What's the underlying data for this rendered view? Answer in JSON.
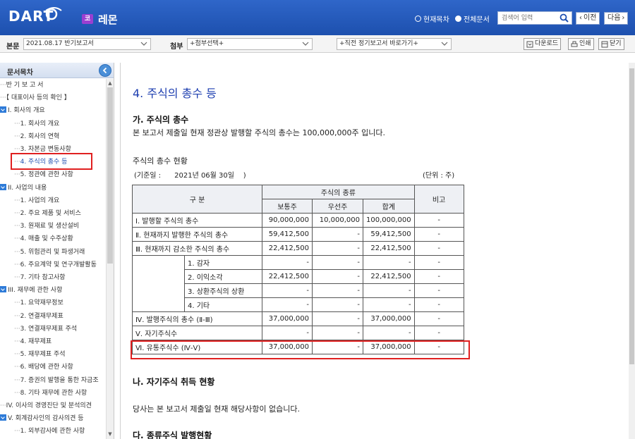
{
  "header": {
    "logo_text": "DART",
    "company_badge": "코",
    "company_name": "레몬",
    "radio_current": "현재목차",
    "radio_all": "전체문서",
    "search_placeholder": "검색어 입력",
    "prev_label": "이전",
    "next_label": "다음"
  },
  "toolbar": {
    "report_label": "본문",
    "report_value": "2021.08.17  반기보고서",
    "attach_label": "첨부",
    "attach_value": "+첨부선택+",
    "direct_value": "+직전 정기보고서 바로가기+",
    "download_label": "다운로드",
    "print_label": "인쇄",
    "close_label": "닫기"
  },
  "sidebar": {
    "title": "문서목차",
    "items": [
      {
        "label": "반 기 보 고 서",
        "prefix": "···",
        "indent": 0,
        "expander": false
      },
      {
        "label": "【 대표이사 등의 확인 】",
        "prefix": "···",
        "indent": 0,
        "expander": false
      },
      {
        "label": "I. 회사의 개요",
        "prefix": "",
        "indent": 0,
        "expander": true
      },
      {
        "label": "1. 회사의 개요",
        "prefix": "···",
        "indent": 1,
        "expander": false
      },
      {
        "label": "2. 회사의 연혁",
        "prefix": "···",
        "indent": 1,
        "expander": false
      },
      {
        "label": "3. 자본금 변동사항",
        "prefix": "···",
        "indent": 1,
        "expander": false
      },
      {
        "label": "4. 주식의 총수 등",
        "prefix": "···",
        "indent": 1,
        "expander": false,
        "active": true
      },
      {
        "label": "5. 정관에 관한 사항",
        "prefix": "···",
        "indent": 1,
        "expander": false
      },
      {
        "label": "II. 사업의 내용",
        "prefix": "",
        "indent": 0,
        "expander": true
      },
      {
        "label": "1. 사업의 개요",
        "prefix": "···",
        "indent": 1,
        "expander": false
      },
      {
        "label": "2. 주요 제품 및 서비스",
        "prefix": "···",
        "indent": 1,
        "expander": false
      },
      {
        "label": "3. 원재료 및 생산설비",
        "prefix": "···",
        "indent": 1,
        "expander": false
      },
      {
        "label": "4. 매출 및 수주상황",
        "prefix": "···",
        "indent": 1,
        "expander": false
      },
      {
        "label": "5. 위험관리 및 파생거래",
        "prefix": "···",
        "indent": 1,
        "expander": false
      },
      {
        "label": "6. 주요계약 및 연구개발활동",
        "prefix": "···",
        "indent": 1,
        "expander": false
      },
      {
        "label": "7. 기타 참고사항",
        "prefix": "···",
        "indent": 1,
        "expander": false
      },
      {
        "label": "III. 재무에 관한 사항",
        "prefix": "",
        "indent": 0,
        "expander": true
      },
      {
        "label": "1. 요약재무정보",
        "prefix": "···",
        "indent": 1,
        "expander": false
      },
      {
        "label": "2. 연결재무제표",
        "prefix": "···",
        "indent": 1,
        "expander": false
      },
      {
        "label": "3. 연결재무제표 주석",
        "prefix": "···",
        "indent": 1,
        "expander": false
      },
      {
        "label": "4. 재무제표",
        "prefix": "···",
        "indent": 1,
        "expander": false
      },
      {
        "label": "5. 재무제표 주석",
        "prefix": "···",
        "indent": 1,
        "expander": false
      },
      {
        "label": "6. 배당에 관한 사항",
        "prefix": "···",
        "indent": 1,
        "expander": false
      },
      {
        "label": "7. 증권의 발행을 통한 자금조",
        "prefix": "···",
        "indent": 1,
        "expander": false
      },
      {
        "label": "8. 기타 재무에 관한 사항",
        "prefix": "···",
        "indent": 1,
        "expander": false
      },
      {
        "label": "IV. 이사의 경영진단 및 분석의견",
        "prefix": "···",
        "indent": 0,
        "expander": false
      },
      {
        "label": "V. 회계감사인의 감사의견 등",
        "prefix": "",
        "indent": 0,
        "expander": true
      },
      {
        "label": "1. 외부감사에 관한 사항",
        "prefix": "···",
        "indent": 1,
        "expander": false
      }
    ]
  },
  "document": {
    "title": "4. 주식의 총수 등",
    "section_a_title": "가. 주식의 총수",
    "section_a_body": "본 보고서 제출일 현재 정관상 발행할 주식의 총수는 100,000,000주 입니다.",
    "table_caption": "주식의 총수 현황",
    "base_date": "(기준일 :      2021년 06월 30일    )",
    "unit": "(단위 : 주)",
    "section_b_title": "나. 자기주식 취득 현황",
    "section_b_body": "당사는 본 보고서 제출일 현재 해당사항이 없습니다.",
    "section_c_title": "다. 종류주식 발행현황"
  },
  "table": {
    "header_category": "구 분",
    "header_types": "주식의 종류",
    "header_remark": "비고",
    "header_common": "보통주",
    "header_preferred": "우선주",
    "header_total": "합계",
    "rows": [
      {
        "label": "Ⅰ. 발행할 주식의 총수",
        "common": "90,000,000",
        "preferred": "10,000,000",
        "total": "100,000,000",
        "remark": "-"
      },
      {
        "label": "Ⅱ. 현재까지 발행한 주식의 총수",
        "common": "59,412,500",
        "preferred": "-",
        "total": "59,412,500",
        "remark": "-"
      },
      {
        "label": "Ⅲ. 현재까지 감소한 주식의 총수",
        "common": "22,412,500",
        "preferred": "-",
        "total": "22,412,500",
        "remark": "-"
      },
      {
        "label": "1. 감자",
        "common": "-",
        "preferred": "-",
        "total": "-",
        "remark": "-"
      },
      {
        "label": "2. 이익소각",
        "common": "22,412,500",
        "preferred": "-",
        "total": "22,412,500",
        "remark": "-"
      },
      {
        "label": "3. 상환주식의 상환",
        "common": "-",
        "preferred": "-",
        "total": "-",
        "remark": "-"
      },
      {
        "label": "4. 기타",
        "common": "-",
        "preferred": "-",
        "total": "-",
        "remark": "-"
      },
      {
        "label": "Ⅳ. 발행주식의 총수 (Ⅱ-Ⅲ)",
        "common": "37,000,000",
        "preferred": "-",
        "total": "37,000,000",
        "remark": "-"
      },
      {
        "label": "Ⅴ. 자기주식수",
        "common": "-",
        "preferred": "-",
        "total": "-",
        "remark": "-"
      },
      {
        "label": "Ⅵ. 유통주식수 (Ⅳ-Ⅴ)",
        "common": "37,000,000",
        "preferred": "-",
        "total": "37,000,000",
        "remark": "-"
      }
    ]
  },
  "colors": {
    "header_bg": "#1d50ae",
    "highlight": "#e02020",
    "title_blue": "#1e3fb0"
  }
}
